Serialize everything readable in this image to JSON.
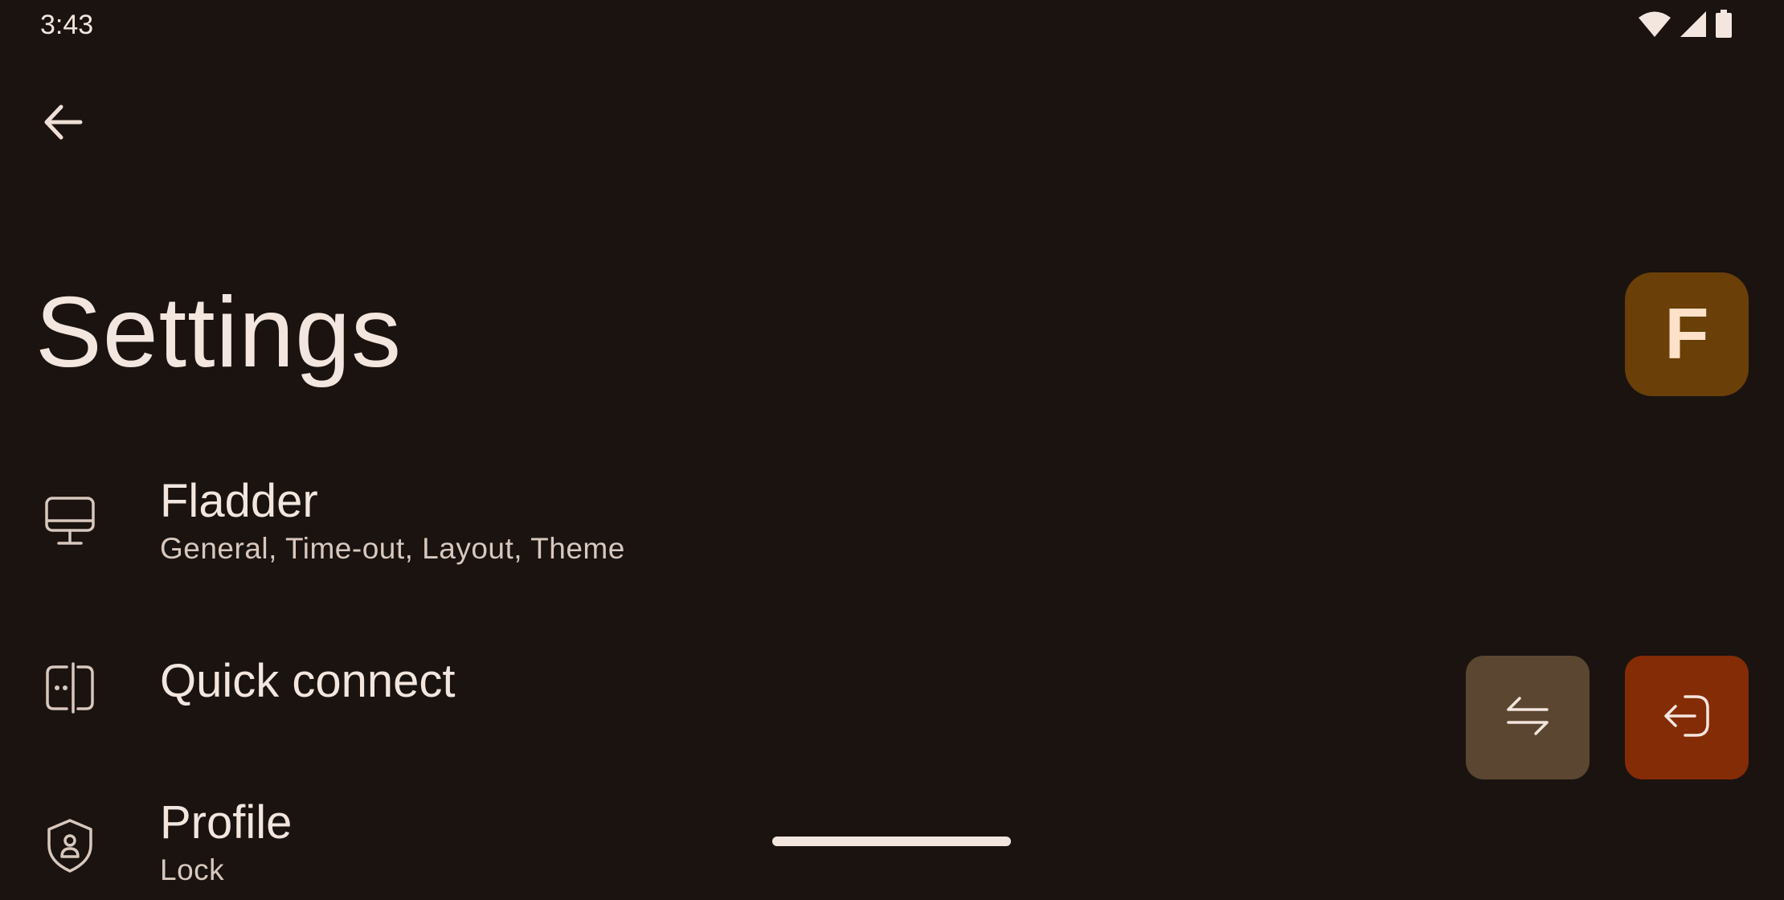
{
  "status_bar": {
    "time": "3:43",
    "icons": [
      "wifi-icon",
      "cellular-signal-icon",
      "battery-icon"
    ]
  },
  "header": {
    "back_icon": "arrow-left-icon",
    "title": "Settings"
  },
  "avatar": {
    "initial": "F",
    "color": "#6a3f08"
  },
  "settings_items": [
    {
      "icon": "monitor-icon",
      "title": "Fladder",
      "subtitle": "General, Time-out, Layout, Theme"
    },
    {
      "icon": "quick-connect-icon",
      "title": "Quick connect",
      "subtitle": ""
    },
    {
      "icon": "profile-shield-icon",
      "title": "Profile",
      "subtitle": "Lock"
    }
  ],
  "actions": {
    "switch_user_icon": "swap-arrows-icon",
    "switch_user_color": "#5b4631",
    "logout_icon": "logout-icon",
    "logout_color": "#842c05"
  },
  "colors": {
    "background": "#1a1310",
    "text_primary": "#f3e6de",
    "text_secondary": "#d8c8bd"
  }
}
